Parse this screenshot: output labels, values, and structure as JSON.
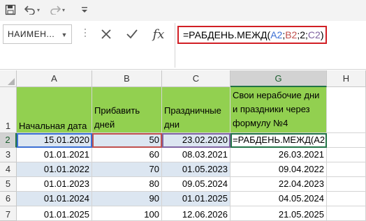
{
  "toolbar": {
    "undo_icon": "undo-arrow",
    "redo_icon": "redo-arrow",
    "more_icon": "customize-caret"
  },
  "formula_bar": {
    "name_box": "НАИМЕН...",
    "cancel_icon": "x-mark",
    "enter_icon": "check-mark",
    "fx_label": "fx",
    "formula_prefix": "=РАБДЕНЬ.МЕЖД(",
    "ref_a": "A2",
    "sep1": ";",
    "ref_b": "B2",
    "sep2": ";2;",
    "ref_c": "C2",
    "formula_suffix": ")"
  },
  "columns": [
    "A",
    "B",
    "C",
    "G",
    "H"
  ],
  "rows": [
    "1",
    "2",
    "3",
    "4",
    "5",
    "6",
    "7"
  ],
  "headers": {
    "a": "Начальная дата",
    "b": "Прибавить дней",
    "c": "Праздничные дни",
    "g": "Свои нерабочие дни и праздники через формулу №4"
  },
  "data": [
    {
      "a": "15.01.2020",
      "b": "50",
      "c": "23.02.2020",
      "g": "=РАБДЕНЬ.МЕЖД(A2;"
    },
    {
      "a": "01.01.2021",
      "b": "60",
      "c": "08.03.2021",
      "g": "26.03.2021"
    },
    {
      "a": "01.01.2022",
      "b": "70",
      "c": "01.05.2023",
      "g": "09.04.2022"
    },
    {
      "a": "01.01.2023",
      "b": "80",
      "c": "09.05.2024",
      "g": "22.04.2023"
    },
    {
      "a": "01.01.2024",
      "b": "90",
      "c": "01.01.2025",
      "g": "04.05.2024"
    },
    {
      "a": "01.01.2025",
      "b": "100",
      "c": "12.06.2026",
      "g": "21.05.2025"
    }
  ],
  "colors": {
    "header_fill": "#92d050",
    "alt_row_fill": "#dce6f1",
    "formula_highlight": "#d11e24",
    "active_accent": "#217346"
  }
}
